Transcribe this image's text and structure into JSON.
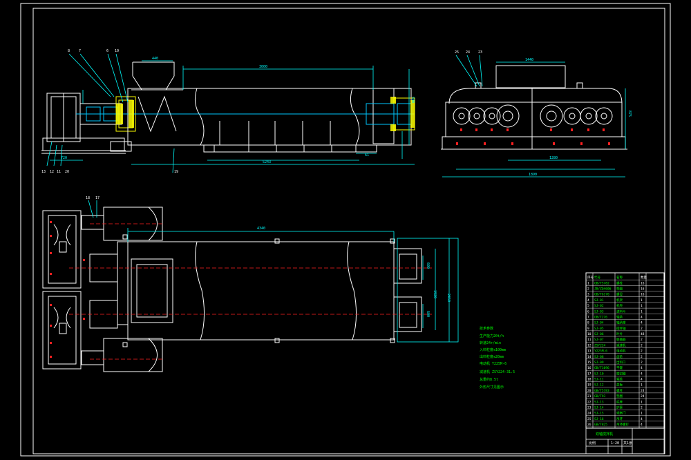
{
  "colors": {
    "background": "#000000",
    "outline": "#ffffff",
    "dimension": "#00ffff",
    "centerline": "#ff2020",
    "notes": "#00ff00",
    "housing": "#ffff00",
    "shaft": "#00c8ff",
    "leader": "#00ffff"
  },
  "balloons_top": [
    "8",
    "7",
    "6",
    "10"
  ],
  "balloons_side": [
    "25",
    "24",
    "23"
  ],
  "balloons_bottom_left": [
    "13",
    "12",
    "11",
    "20",
    "19"
  ],
  "balloons_plan": [
    "18",
    "17"
  ],
  "dimensions": {
    "hopper_width": "440",
    "cylinder_length": "3000",
    "overall_length": "5243",
    "base_pad": "61",
    "end_size": "600",
    "left_base": "720",
    "side_top": "1440",
    "side_width": "1280",
    "side_overall": "1890",
    "side_height": "875",
    "plan_length": "4340",
    "plan_width": "2450",
    "plan_inner": "1920",
    "plan_port_a": "600",
    "plan_port_b": "600"
  },
  "notes": {
    "title": "技术参数",
    "lines": [
      "生产能力20t/h",
      "转速24r/min",
      "入料粒度≤100mm",
      "出料粒度≤20mm",
      "电动机 Y225M-6",
      "减速机 ZSY224-31.5",
      "总重约8.5t",
      "外形尺寸见图示"
    ]
  },
  "title_block": {
    "bottom_title": "双轴搅拌机",
    "cell_a": "比例",
    "cell_b": "1:20",
    "cell_c": "共1张"
  },
  "bom": {
    "rows": [
      [
        "1",
        "GB/T5782",
        "螺栓",
        "16"
      ],
      [
        "2",
        "JB/ZQ4606",
        "垫圈",
        "16"
      ],
      [
        "3",
        "GB/T6170",
        "螺母",
        "16"
      ],
      [
        "4",
        "SJ-01",
        "机架",
        "1"
      ],
      [
        "5",
        "SJ-02",
        "机壳",
        "1"
      ],
      [
        "6",
        "SJ-03",
        "进料斗",
        "1"
      ],
      [
        "7",
        "GB/T276",
        "轴承",
        "4"
      ],
      [
        "8",
        "SJ-04",
        "轴承座",
        "4"
      ],
      [
        "9",
        "SJ-05",
        "搅拌轴",
        "2"
      ],
      [
        "10",
        "SJ-06",
        "叶片",
        "48"
      ],
      [
        "11",
        "SJ-07",
        "联轴器",
        "2"
      ],
      [
        "12",
        "ZSY224",
        "减速机",
        "2"
      ],
      [
        "13",
        "Y225M-6",
        "电动机",
        "2"
      ],
      [
        "14",
        "SJ-08",
        "齿轮",
        "2"
      ],
      [
        "15",
        "SJ-09",
        "出料口",
        "2"
      ],
      [
        "16",
        "GB/T1096",
        "平键",
        "4"
      ],
      [
        "17",
        "SJ-10",
        "密封圈",
        "4"
      ],
      [
        "18",
        "SJ-11",
        "端盖",
        "4"
      ],
      [
        "19",
        "SJ-12",
        "盖板",
        "1"
      ],
      [
        "20",
        "GB/T5783",
        "螺栓",
        "24"
      ],
      [
        "21",
        "GB/T93",
        "垫圈",
        "24"
      ],
      [
        "22",
        "SJ-13",
        "底座",
        "1"
      ],
      [
        "23",
        "SJ-14",
        "护罩",
        "2"
      ],
      [
        "24",
        "SJ-15",
        "观察门",
        "1"
      ],
      [
        "25",
        "SJ-16",
        "吊环",
        "4"
      ],
      [
        "26",
        "GB/T825",
        "吊环螺钉",
        "4"
      ]
    ],
    "header": [
      "序号",
      "代号",
      "名称",
      "数量"
    ]
  }
}
